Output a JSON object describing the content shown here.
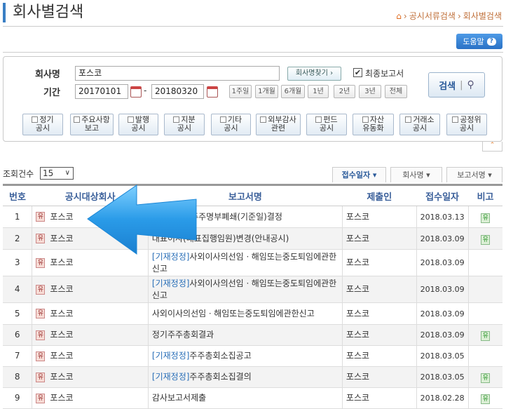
{
  "header": {
    "title": "회사별검색",
    "breadcrumb": [
      "공시서류검색",
      "회사별검색"
    ],
    "help_label": "도움말",
    "help_icon": "?"
  },
  "search": {
    "company_label": "회사명",
    "company_value": "포스코",
    "find_company_label": "회사명찾기 ›",
    "final_report_label": "최종보고서",
    "final_report_checked": true,
    "period_label": "기간",
    "start_date": "20170101",
    "end_date": "20180320",
    "period_sep": "-",
    "period_buttons": [
      "1주일",
      "1개월",
      "6개월",
      "1년",
      "2년",
      "3년",
      "전체"
    ],
    "search_label": "검색",
    "categories": [
      [
        "정기",
        "공시"
      ],
      [
        "주요사항",
        "보고"
      ],
      [
        "발행",
        "공시"
      ],
      [
        "지분",
        "공시"
      ],
      [
        "기타",
        "공시"
      ],
      [
        "외부감사",
        "관련"
      ],
      [
        "펀드",
        "공시"
      ],
      [
        "자산",
        "유동화"
      ],
      [
        "거래소",
        "공시"
      ],
      [
        "공정위",
        "공시"
      ]
    ]
  },
  "list": {
    "count_label": "조회건수",
    "count_value": "15",
    "sort_tabs": [
      "접수일자 ▾",
      "회사명 ▾",
      "보고서명 ▾"
    ],
    "columns": [
      "번호",
      "공시대상회사",
      "보고서명",
      "제출인",
      "접수일자",
      "비고"
    ],
    "rows": [
      {
        "no": "1",
        "tag": "유",
        "company": "포스코",
        "prefix": "",
        "report": "배당을위한주주명부폐쇄(기준일)결정",
        "submitter": "포스코",
        "date": "2018.03.13",
        "note": "유"
      },
      {
        "no": "2",
        "tag": "유",
        "company": "포스코",
        "prefix": "",
        "report": "대표이사(대표집행임원)변경(안내공시)",
        "submitter": "포스코",
        "date": "2018.03.09",
        "note": "유"
      },
      {
        "no": "3",
        "tag": "유",
        "company": "포스코",
        "prefix": "[기재정정]",
        "report": "사외이사의선임ㆍ해임또는중도퇴임에관한신고",
        "submitter": "포스코",
        "date": "2018.03.09",
        "note": ""
      },
      {
        "no": "4",
        "tag": "유",
        "company": "포스코",
        "prefix": "[기재정정]",
        "report": "사외이사의선임ㆍ해임또는중도퇴임에관한신고",
        "submitter": "포스코",
        "date": "2018.03.09",
        "note": ""
      },
      {
        "no": "5",
        "tag": "유",
        "company": "포스코",
        "prefix": "",
        "report": "사외이사의선임ㆍ해임또는중도퇴임에관한신고",
        "submitter": "포스코",
        "date": "2018.03.09",
        "note": ""
      },
      {
        "no": "6",
        "tag": "유",
        "company": "포스코",
        "prefix": "",
        "report": "정기주주총회결과",
        "submitter": "포스코",
        "date": "2018.03.09",
        "note": "유"
      },
      {
        "no": "7",
        "tag": "유",
        "company": "포스코",
        "prefix": "[기재정정]",
        "report": "주주총회소집공고",
        "submitter": "포스코",
        "date": "2018.03.05",
        "note": ""
      },
      {
        "no": "8",
        "tag": "유",
        "company": "포스코",
        "prefix": "[기재정정]",
        "report": "주주총회소집결의",
        "submitter": "포스코",
        "date": "2018.03.05",
        "note": "유"
      },
      {
        "no": "9",
        "tag": "유",
        "company": "포스코",
        "prefix": "",
        "report": "감사보고서제출",
        "submitter": "포스코",
        "date": "2018.02.28",
        "note": "유"
      }
    ]
  }
}
